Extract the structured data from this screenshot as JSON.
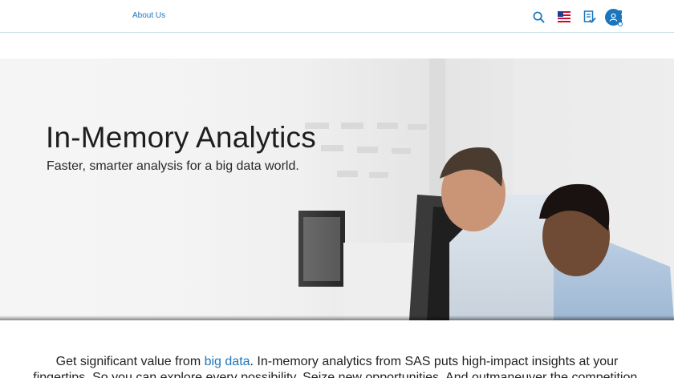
{
  "nav": {
    "about_label": "About Us"
  },
  "tools": {
    "icons": [
      "search-icon",
      "us-flag-icon",
      "document-check-icon",
      "grid-menu-icon",
      "user-icon"
    ]
  },
  "hero": {
    "title": "In-Memory Analytics",
    "subtitle": "Faster, smarter analysis for a big data world."
  },
  "intro": {
    "lead": "Get significant value from ",
    "link": "big data",
    "rest": ". In-memory analytics from SAS puts high-impact insights at your fingertips. So you can explore every possibility. Seize new opportunities. And outmaneuver the competition."
  },
  "colors": {
    "accent": "#1b75bc",
    "text": "#1e1e1e"
  }
}
